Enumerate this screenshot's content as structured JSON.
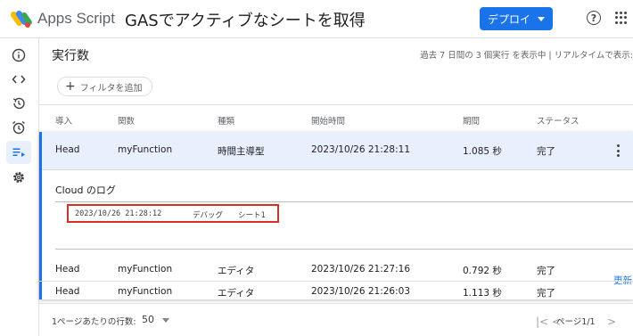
{
  "header": {
    "app_name": "Apps Script",
    "project_title": "GASでアクティブなシートを取得",
    "deploy_label": "デプロイ",
    "help_glyph": "?"
  },
  "sidebar": {
    "items": [
      {
        "icon": "info-icon"
      },
      {
        "icon": "code-icon"
      },
      {
        "icon": "history-icon"
      },
      {
        "icon": "alarm-icon"
      },
      {
        "icon": "executions-icon",
        "active": true
      },
      {
        "icon": "gear-icon"
      }
    ]
  },
  "main": {
    "title": "実行数",
    "summary": "過去 7 日間の 3 個実行 を表示中 | リアルタイムで表示:",
    "filter_label": "フィルタを追加",
    "columns": [
      "導入",
      "関数",
      "種類",
      "開始時間",
      "期間",
      "ステータス"
    ],
    "selected_row": {
      "deployment": "Head",
      "function": "myFunction",
      "type": "時間主導型",
      "start": "2023/10/26 21:28:11",
      "duration": "1.085 秒",
      "status": "完了"
    },
    "log": {
      "title": "Cloud のログ",
      "entry": {
        "timestamp": "2023/10/26 21:28:12",
        "level": "デバッグ",
        "message": "シート1"
      },
      "refresh_label": "更新"
    },
    "rows": [
      {
        "deployment": "Head",
        "function": "myFunction",
        "type": "エディタ",
        "start": "2023/10/26 21:27:16",
        "duration": "0.792 秒",
        "status": "完了"
      },
      {
        "deployment": "Head",
        "function": "myFunction",
        "type": "エディタ",
        "start": "2023/10/26 21:26:03",
        "duration": "1.113 秒",
        "status": "完了"
      }
    ],
    "footer": {
      "rows_per_page_label": "1ページあたりの行数:",
      "rows_per_page_value": "50",
      "page_label": "ページ1/1"
    }
  },
  "colors": {
    "accent": "#1a73e8",
    "selected_bg": "#e8f0fe",
    "highlight": "#d93025"
  }
}
